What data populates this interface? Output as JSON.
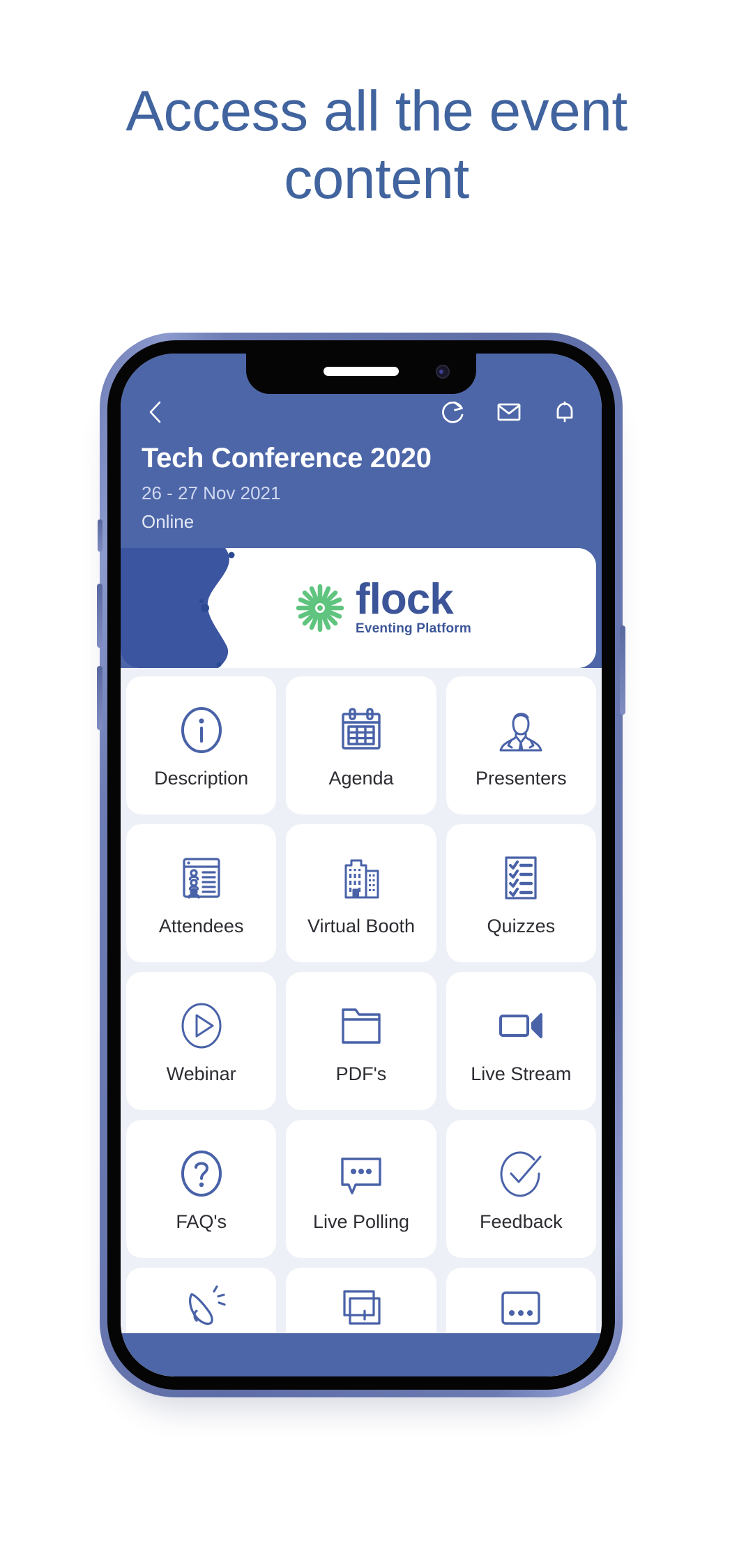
{
  "headline": "Access all the event content",
  "theme": {
    "headline_color": "#41649f",
    "header_blue": "#4d66a8",
    "screen_bg": "#eef0f8",
    "tile_bg": "#ffffff",
    "icon_blue": "#4962a8",
    "logo_blue": "#3c5599",
    "logo_green": "#5fc47e"
  },
  "phone": {
    "header": {
      "back_icon": "chevron-left-icon",
      "actions": [
        {
          "icon": "refresh-icon",
          "name": "refresh"
        },
        {
          "icon": "envelope-icon",
          "name": "messages"
        },
        {
          "icon": "bell-icon",
          "name": "notifications"
        }
      ],
      "event_title": "Tech Conference 2020",
      "event_date": "26 - 27 Nov 2021",
      "event_location": "Online"
    },
    "banner": {
      "logo_word": "flock",
      "logo_subtitle": "Eventing Platform",
      "logo_mark": "flower-burst-icon"
    },
    "tiles": [
      {
        "label": "Description",
        "icon": "info-circle-icon"
      },
      {
        "label": "Agenda",
        "icon": "calendar-icon"
      },
      {
        "label": "Presenters",
        "icon": "presenter-person-icon"
      },
      {
        "label": "Attendees",
        "icon": "attendee-list-icon"
      },
      {
        "label": "Virtual Booth",
        "icon": "buildings-icon"
      },
      {
        "label": "Quizzes",
        "icon": "checklist-icon"
      },
      {
        "label": "Webinar",
        "icon": "play-circle-icon"
      },
      {
        "label": "PDF's",
        "icon": "folder-icon"
      },
      {
        "label": "Live Stream",
        "icon": "video-camera-icon"
      },
      {
        "label": "FAQ's",
        "icon": "question-circle-icon"
      },
      {
        "label": "Live Polling",
        "icon": "chat-bubble-dots-icon"
      },
      {
        "label": "Feedback",
        "icon": "check-circle-icon"
      }
    ],
    "partial_tiles": [
      {
        "label": "",
        "icon": "hand-tap-icon"
      },
      {
        "label": "",
        "icon": "windows-gallery-icon"
      },
      {
        "label": "",
        "icon": "more-dots-box-icon"
      }
    ]
  }
}
